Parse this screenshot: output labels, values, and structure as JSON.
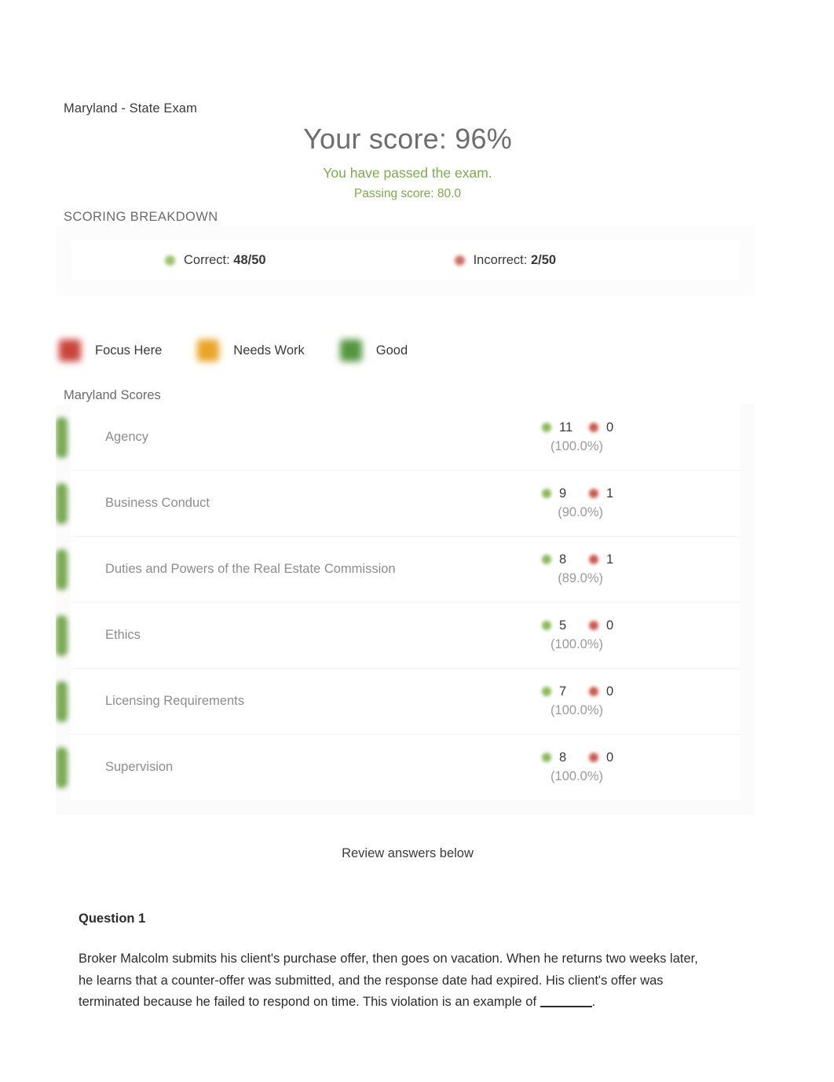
{
  "exam": {
    "title": "Maryland - State Exam",
    "score_headline": "Your score: 96%",
    "pass_message": "You have passed the exam.",
    "passing_score": "Passing score: 80.0"
  },
  "breakdown": {
    "label": "SCORING BREAKDOWN",
    "correct_label": "Correct:",
    "correct_value": "48/50",
    "incorrect_label": "Incorrect:",
    "incorrect_value": "2/50",
    "correct_icon": "green-dot-icon",
    "incorrect_icon": "red-dot-icon"
  },
  "legend": {
    "items": [
      {
        "label": "Focus Here",
        "color": "#c9453c"
      },
      {
        "label": "Needs Work",
        "color": "#e9a526"
      },
      {
        "label": "Good",
        "color": "#54963f"
      }
    ]
  },
  "scores": {
    "title": "Maryland Scores",
    "rows": [
      {
        "category": "Agency",
        "correct": "11",
        "incorrect": "0",
        "percent": "(100.0%)",
        "status": "good"
      },
      {
        "category": "Business Conduct",
        "correct": "9",
        "incorrect": "1",
        "percent": "(90.0%)",
        "status": "good"
      },
      {
        "category": "Duties and Powers of the Real Estate Commission",
        "correct": "8",
        "incorrect": "1",
        "percent": "(89.0%)",
        "status": "good"
      },
      {
        "category": "Ethics",
        "correct": "5",
        "incorrect": "0",
        "percent": "(100.0%)",
        "status": "good"
      },
      {
        "category": "Licensing Requirements",
        "correct": "7",
        "incorrect": "0",
        "percent": "(100.0%)",
        "status": "good"
      },
      {
        "category": "Supervision",
        "correct": "8",
        "incorrect": "0",
        "percent": "(100.0%)",
        "status": "good"
      }
    ]
  },
  "review": {
    "note": "Review answers below",
    "question_heading": "Question 1",
    "question_text_a": "Broker Malcolm submits his client's purchase offer, then goes on vacation. When he returns two weeks later, he learns that a counter-offer was submitted, and the response date had expired. His client's offer was terminated because he failed to respond on time. This violation is an example of",
    "question_text_b": "."
  },
  "chart_data": {
    "type": "bar",
    "title": "Maryland Scores",
    "categories": [
      "Agency",
      "Business Conduct",
      "Duties and Powers of the Real Estate Commission",
      "Ethics",
      "Licensing Requirements",
      "Supervision"
    ],
    "series": [
      {
        "name": "Correct",
        "values": [
          11,
          9,
          8,
          5,
          7,
          8
        ]
      },
      {
        "name": "Incorrect",
        "values": [
          0,
          1,
          1,
          0,
          0,
          0
        ]
      }
    ],
    "percent_values": [
      100.0,
      90.0,
      89.0,
      100.0,
      100.0,
      100.0
    ],
    "overall": {
      "correct": 48,
      "total": 50,
      "percent": 96,
      "passing_score": 80.0
    },
    "legend": [
      "Focus Here",
      "Needs Work",
      "Good"
    ],
    "xlabel": "",
    "ylabel": "",
    "ylim": [
      0,
      11
    ]
  }
}
